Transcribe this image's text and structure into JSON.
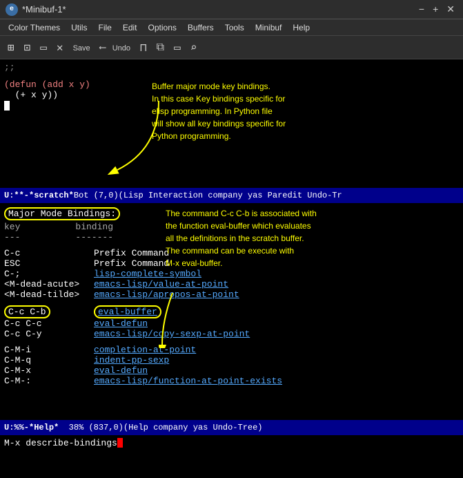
{
  "titleBar": {
    "title": "*Minibuf-1*",
    "minBtn": "−",
    "maxBtn": "+",
    "closeBtn": "✕"
  },
  "menuBar": {
    "items": [
      "Color Themes",
      "Utils",
      "File",
      "Edit",
      "Options",
      "Buffers",
      "Tools",
      "Minibuf",
      "Help"
    ]
  },
  "toolbar": {
    "buttons": [
      "＋",
      "⊡",
      "💾",
      "✕",
      "💾",
      "⟵",
      "🔖",
      "⧉",
      "📋",
      "🔍"
    ],
    "saveLabel": "Save",
    "undoLabel": "Undo"
  },
  "editor": {
    "commentLine": ";;",
    "code1": "(defun (add x y)",
    "code2": "  (+ x y))",
    "annotation": "Buffer major mode key bindings.\nIn this case Key bindings specific for\nelisp programming. In Python file\nwill show all key bindings specific for\nPython programming."
  },
  "modeLine1": {
    "prefix": "U:**-  ",
    "buffer": "*scratch*",
    "position": "  Bot (7,0)",
    "modes": "    (Lisp Interaction company yas Paredit Undo-Tr"
  },
  "helpArea": {
    "annotation": "The command C-c C-b is associated with\nthe function eval-buffer which evaluates\nall the definitions in the scratch buffer.\nThe command can be execute with\nM-x eval-buffer.",
    "titleLine": "Major Mode Bindings:",
    "col1Header": "key",
    "col2Header": "binding",
    "rows": [
      {
        "key": "C-c",
        "binding": "Prefix Command",
        "underline": false,
        "spacerBefore": true
      },
      {
        "key": "ESC",
        "binding": "Prefix Command",
        "underline": false
      },
      {
        "key": "C-;",
        "binding": "lisp-complete-symbol",
        "underline": true
      },
      {
        "key": "<M-dead-acute>",
        "binding": "emacs-lisp/value-at-point",
        "underline": true
      },
      {
        "key": "<M-dead-tilde>",
        "binding": "emacs-lisp/apropos-at-point",
        "underline": true
      },
      {
        "key": "C-c C-b",
        "binding": "eval-buffer",
        "underline": true,
        "highlight": true,
        "spacerBefore": true
      },
      {
        "key": "C-c C-c",
        "binding": "eval-defun",
        "underline": true
      },
      {
        "key": "C-c C-y",
        "binding": "emacs-lisp/copy-sexp-at-point",
        "underline": true
      },
      {
        "key": "C-M-i",
        "binding": "completion-at-point",
        "underline": true,
        "spacerBefore": true
      },
      {
        "key": "C-M-q",
        "binding": "indent-pp-sexp",
        "underline": true
      },
      {
        "key": "C-M-x",
        "binding": "eval-defun",
        "underline": true
      },
      {
        "key": "C-M-:",
        "binding": "emacs-lisp/function-at-point-exists",
        "underline": true
      }
    ]
  },
  "modeLine2": {
    "prefix": "U:%%-  ",
    "buffer": "*Help*",
    "percent": "38%",
    "position": "(837,0)",
    "modes": "   (Help company yas Undo-Tree)"
  },
  "minibuf": {
    "prompt": "M-x describe-bindings"
  }
}
